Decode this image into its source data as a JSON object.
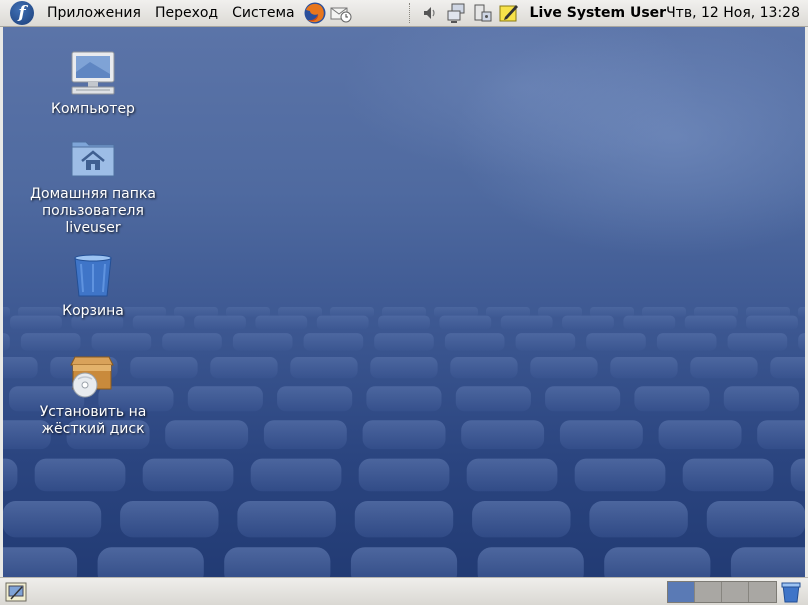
{
  "top_panel": {
    "menus": [
      "Приложения",
      "Переход",
      "Система"
    ],
    "user": "Live System User",
    "clock": "Чтв, 12 Ноя, 13:28",
    "logo_letter": "f"
  },
  "desktop": {
    "icons": [
      {
        "label": "Компьютер",
        "icon": "computer-icon"
      },
      {
        "label": "Домашняя папка\nпользователя\nliveuser",
        "icon": "home-folder-icon"
      },
      {
        "label": "Корзина",
        "icon": "trash-icon"
      },
      {
        "label": "Установить на\nжёсткий диск",
        "icon": "install-disk-icon"
      }
    ]
  },
  "bottom_panel": {
    "workspaces": [
      {
        "active": true
      },
      {
        "active": false
      },
      {
        "active": false
      },
      {
        "active": false
      }
    ]
  },
  "colors": {
    "desktop_top": "#5b74a8",
    "desktop_bottom": "#223b74",
    "tile": "#4d6aa8",
    "workspace_active": "#5a7ab5"
  }
}
